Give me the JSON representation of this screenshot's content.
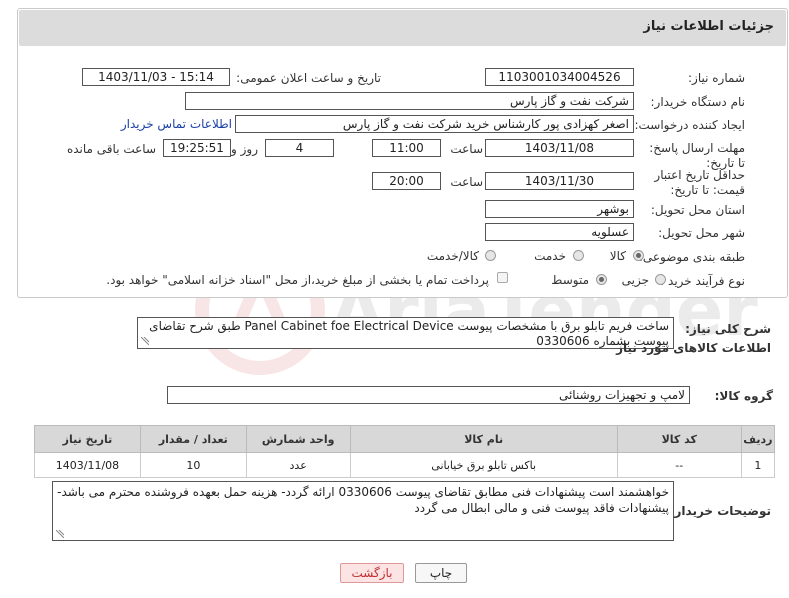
{
  "panel": {
    "title": "جزئیات اطلاعات نیاز"
  },
  "fields": {
    "need_number_label": "شماره نیاز:",
    "need_number": "1103001034004526",
    "announce_label": "تاریخ و ساعت اعلان عمومی:",
    "announce_value": "1403/11/03 - 15:14",
    "buyer_org_label": "نام دستگاه خریدار:",
    "buyer_org": "شرکت نفت و گاز پارس",
    "creator_label": "ایجاد کننده درخواست:",
    "creator": "اصغر کهزادی پور کارشناس خرید شرکت نفت و گاز پارس",
    "contact_link": "اطلاعات تماس خریدار",
    "deadline_label": "مهلت ارسال پاسخ: تا تاریخ:",
    "deadline_date": "1403/11/08",
    "time_label": "ساعت",
    "deadline_time": "11:00",
    "days_value": "4",
    "days_label": "روز و",
    "remaining_time": "19:25:51",
    "remaining_label": "ساعت باقی مانده",
    "price_validity_label": "حداقل تاریخ اعتبار قیمت: تا تاریخ:",
    "price_validity_date": "1403/11/30",
    "price_validity_time": "20:00",
    "province_label": "استان محل تحویل:",
    "province": "بوشهر",
    "city_label": "شهر محل تحویل:",
    "city": "عسلویه",
    "category_label": "طبقه بندی موضوعی:",
    "category_options": [
      "کالا",
      "خدمت",
      "کالا/خدمت"
    ],
    "process_label": "نوع فرآیند خرید :",
    "process_options": [
      "جزیی",
      "متوسط"
    ],
    "payment_note": "پرداخت تمام یا بخشی از مبلغ خرید،از محل \"اسناد خزانه اسلامی\" خواهد بود."
  },
  "description": {
    "label": "شرح کلی نیاز:",
    "text": "ساخت فریم تابلو برق با مشخصات پیوست Panel Cabinet foe Electrical Device طبق شرح تقاضای پیوست بشماره 0330606"
  },
  "goods": {
    "section_title": "اطلاعات کالاهای مورد نیاز",
    "group_label": "گروه کالا:",
    "group_value": "لامپ و تجهیزات روشنائی",
    "columns": [
      "ردیف",
      "کد کالا",
      "نام کالا",
      "واحد شمارش",
      "تعداد / مقدار",
      "تاریخ نیاز"
    ],
    "rows": [
      [
        "1",
        "--",
        "باکس تابلو برق خیابانی",
        "عدد",
        "10",
        "1403/11/08"
      ]
    ]
  },
  "buyer_notes": {
    "label": "توضیحات خریدار:",
    "text": "خواهشمند است پیشنهادات فنی مطابق تقاضای پیوست 0330606 ارائه گردد- هزینه حمل بعهده فروشنده محترم می باشد- پیشنهادات فاقد پیوست فنی و مالی ابطال می گردد"
  },
  "buttons": {
    "print": "چاپ",
    "back": "بازگشت"
  },
  "colors": {
    "header_bg": "#dcdcdc",
    "link": "#1a3fa8",
    "back_btn_bg": "#fce4e4",
    "back_btn_text": "#c03030"
  }
}
